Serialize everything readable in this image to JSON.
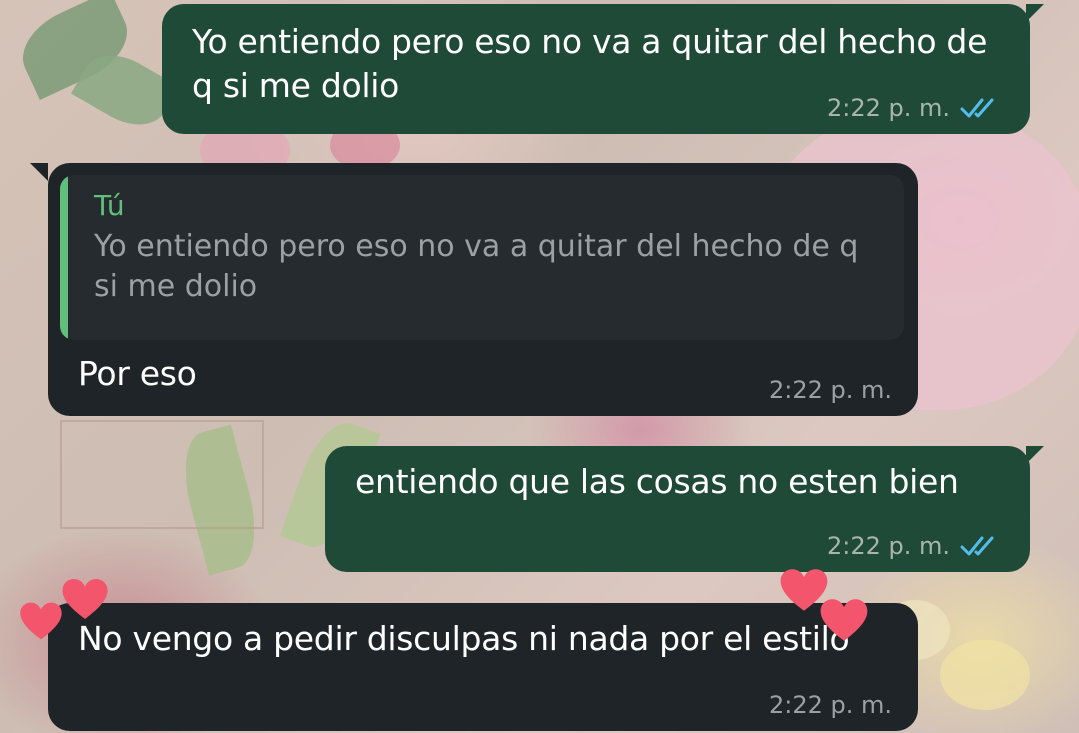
{
  "wallpaper": {
    "theme": "floral-pastel"
  },
  "colors": {
    "outgoing_bubble": "#1f4a37",
    "incoming_bubble": "#1f2428",
    "quote_accent": "#5fbf7b",
    "read_ticks": "#53bdeb",
    "heart": "#f2556c"
  },
  "messages": [
    {
      "direction": "outgoing",
      "text": "Yo entiendo pero eso no va a quitar del hecho de q si me dolio",
      "time": "2:22 p. m.",
      "status_icon": "double-check-read-icon"
    },
    {
      "direction": "incoming",
      "quote": {
        "author": "Tú",
        "text": "Yo entiendo pero eso no va a quitar del hecho de q si me dolio"
      },
      "text": "Por eso",
      "time": "2:22 p. m."
    },
    {
      "direction": "outgoing",
      "text": "entiendo que las cosas no esten bien",
      "time": "2:22 p. m.",
      "status_icon": "double-check-read-icon"
    },
    {
      "direction": "incoming",
      "text": "No vengo a pedir disculpas ni nada por el estilo",
      "time": "2:22 p. m."
    }
  ],
  "stickers": [
    "heart-icon",
    "heart-icon",
    "heart-icon",
    "heart-icon"
  ]
}
